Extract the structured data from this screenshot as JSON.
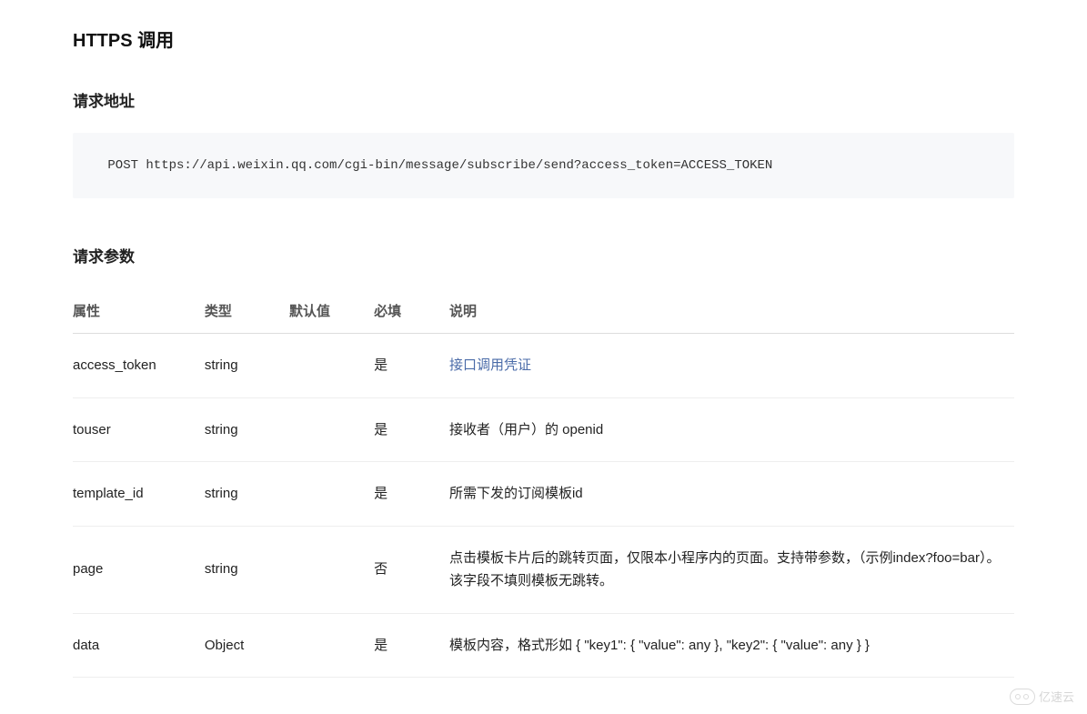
{
  "section_title": "HTTPS 调用",
  "request_url_heading": "请求地址",
  "code_block": " POST https://api.weixin.qq.com/cgi-bin/message/subscribe/send?access_token=ACCESS_TOKEN",
  "request_params_heading": "请求参数",
  "table": {
    "headers": [
      "属性",
      "类型",
      "默认值",
      "必填",
      "说明"
    ],
    "rows": [
      {
        "attr": "access_token",
        "type": "string",
        "default": "",
        "required": "是",
        "desc": "接口调用凭证",
        "desc_is_link": true
      },
      {
        "attr": "touser",
        "type": "string",
        "default": "",
        "required": "是",
        "desc": "接收者（用户）的 openid",
        "desc_is_link": false
      },
      {
        "attr": "template_id",
        "type": "string",
        "default": "",
        "required": "是",
        "desc": "所需下发的订阅模板id",
        "desc_is_link": false
      },
      {
        "attr": "page",
        "type": "string",
        "default": "",
        "required": "否",
        "desc": "点击模板卡片后的跳转页面，仅限本小程序内的页面。支持带参数，（示例index?foo=bar）。该字段不填则模板无跳转。",
        "desc_is_link": false
      },
      {
        "attr": "data",
        "type": "Object",
        "default": "",
        "required": "是",
        "desc": "模板内容，格式形如 { \"key1\": { \"value\": any }, \"key2\": { \"value\": any } }",
        "desc_is_link": false
      }
    ]
  },
  "watermark_text": "亿速云"
}
